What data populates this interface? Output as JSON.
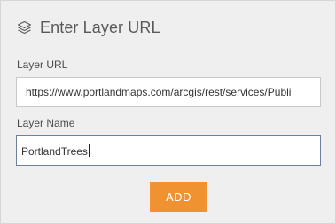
{
  "dialog": {
    "title": "Enter Layer URL",
    "icon": "layers-icon"
  },
  "form": {
    "url_label": "Layer URL",
    "url_value": "https://www.portlandmaps.com/arcgis/rest/services/Publi",
    "name_label": "Layer Name",
    "name_value": "PortlandTrees"
  },
  "actions": {
    "add_label": "ADD",
    "add_color": "#f0922f"
  }
}
